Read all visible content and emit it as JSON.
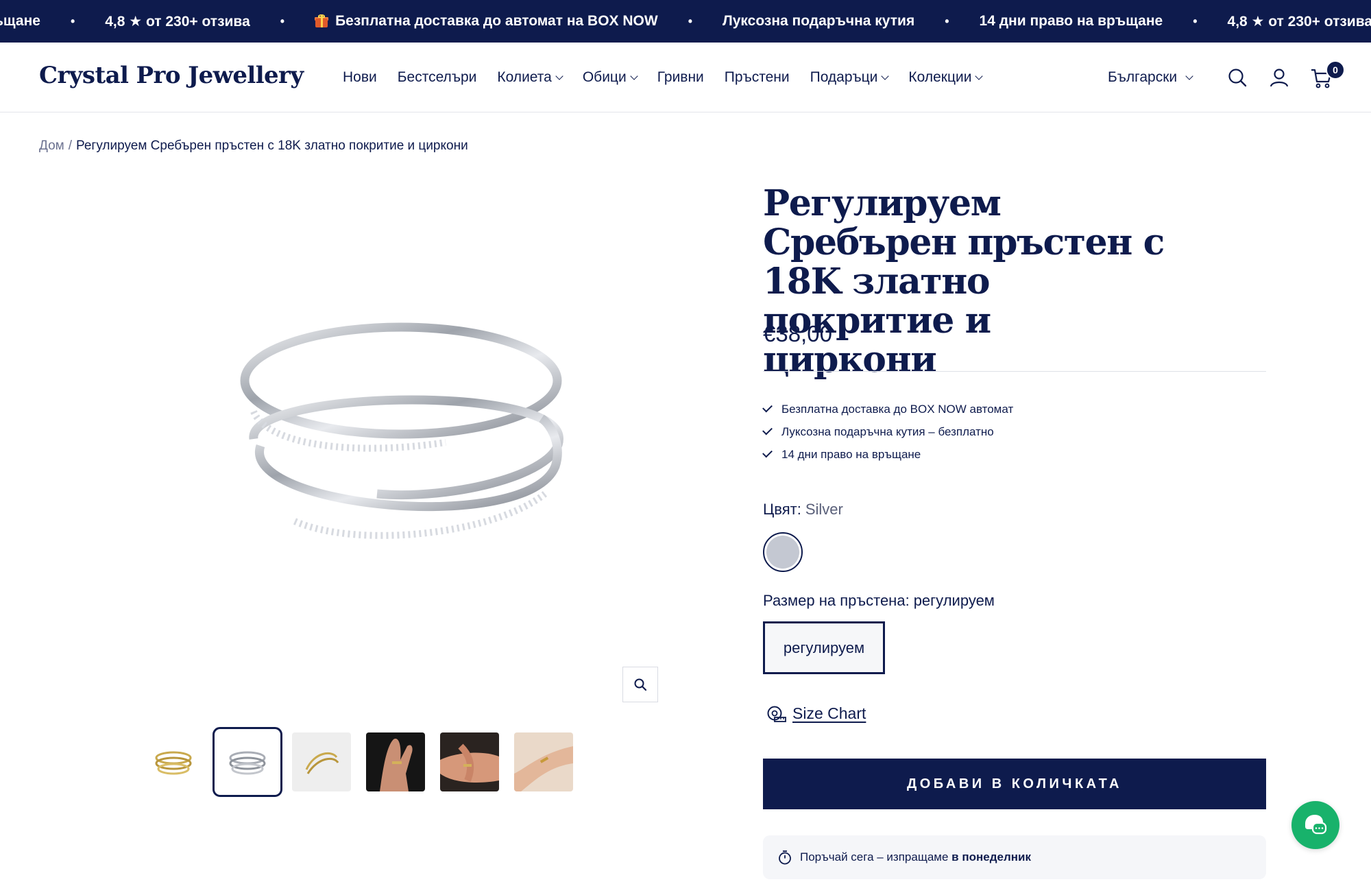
{
  "announcement": {
    "items": [
      "ьщане",
      "4,8 ★ от 230+ отзива",
      "Безплатна доставка до автомат на BOX NOW",
      "Луксозна подаръчна кутия",
      "14 дни право на връщане",
      "4,8 ★ от 230+ отзива"
    ],
    "separator": "•",
    "gift_icon": "gift-icon"
  },
  "header": {
    "logo": "Crystal Pro Jewellery",
    "nav": [
      {
        "label": "Нови",
        "dropdown": false
      },
      {
        "label": "Бестселъри",
        "dropdown": false
      },
      {
        "label": "Колиета",
        "dropdown": true
      },
      {
        "label": "Обици",
        "dropdown": true
      },
      {
        "label": "Гривни",
        "dropdown": false
      },
      {
        "label": "Пръстени",
        "dropdown": false
      },
      {
        "label": "Подаръци",
        "dropdown": true
      },
      {
        "label": "Колекции",
        "dropdown": true
      }
    ],
    "language": "Български",
    "cart_count": "0",
    "icons": [
      "search-icon",
      "account-icon",
      "cart-icon"
    ]
  },
  "breadcrumb": {
    "home": "Дом",
    "separator": "/",
    "current": "Регулируем Сребърен пръстен с 18K златно покритие и циркони"
  },
  "product": {
    "title": "Регулируем Сребърен пръстен с 18K златно покритие и циркони",
    "price": "€38,00",
    "perks": [
      "Безплатна доставка до BOX NOW автомат",
      "Луксозна подаръчна кутия – безплатно",
      "14 дни право на връщане"
    ],
    "color_label": "Цвят:",
    "color_value": "Silver",
    "swatch_color": "#c4c8d2",
    "size_label": "Размер на пръстена:",
    "size_value": "регулируем",
    "size_option": "регулируем",
    "size_chart": "Size Chart",
    "add_to_cart": "ДОБАВИ В КОЛИЧКАТА",
    "ship_text": "Поръчай сега – изпращаме",
    "ship_day": "в понеделник"
  },
  "gallery": {
    "thumbnails": [
      "gold-ring",
      "silver-ring",
      "gold-ring-grey",
      "hand-dark",
      "hand-arm",
      "hand-gold"
    ],
    "active_index": 1
  },
  "colors": {
    "navy": "#0e1b4d",
    "chat_green": "#18b26b"
  }
}
